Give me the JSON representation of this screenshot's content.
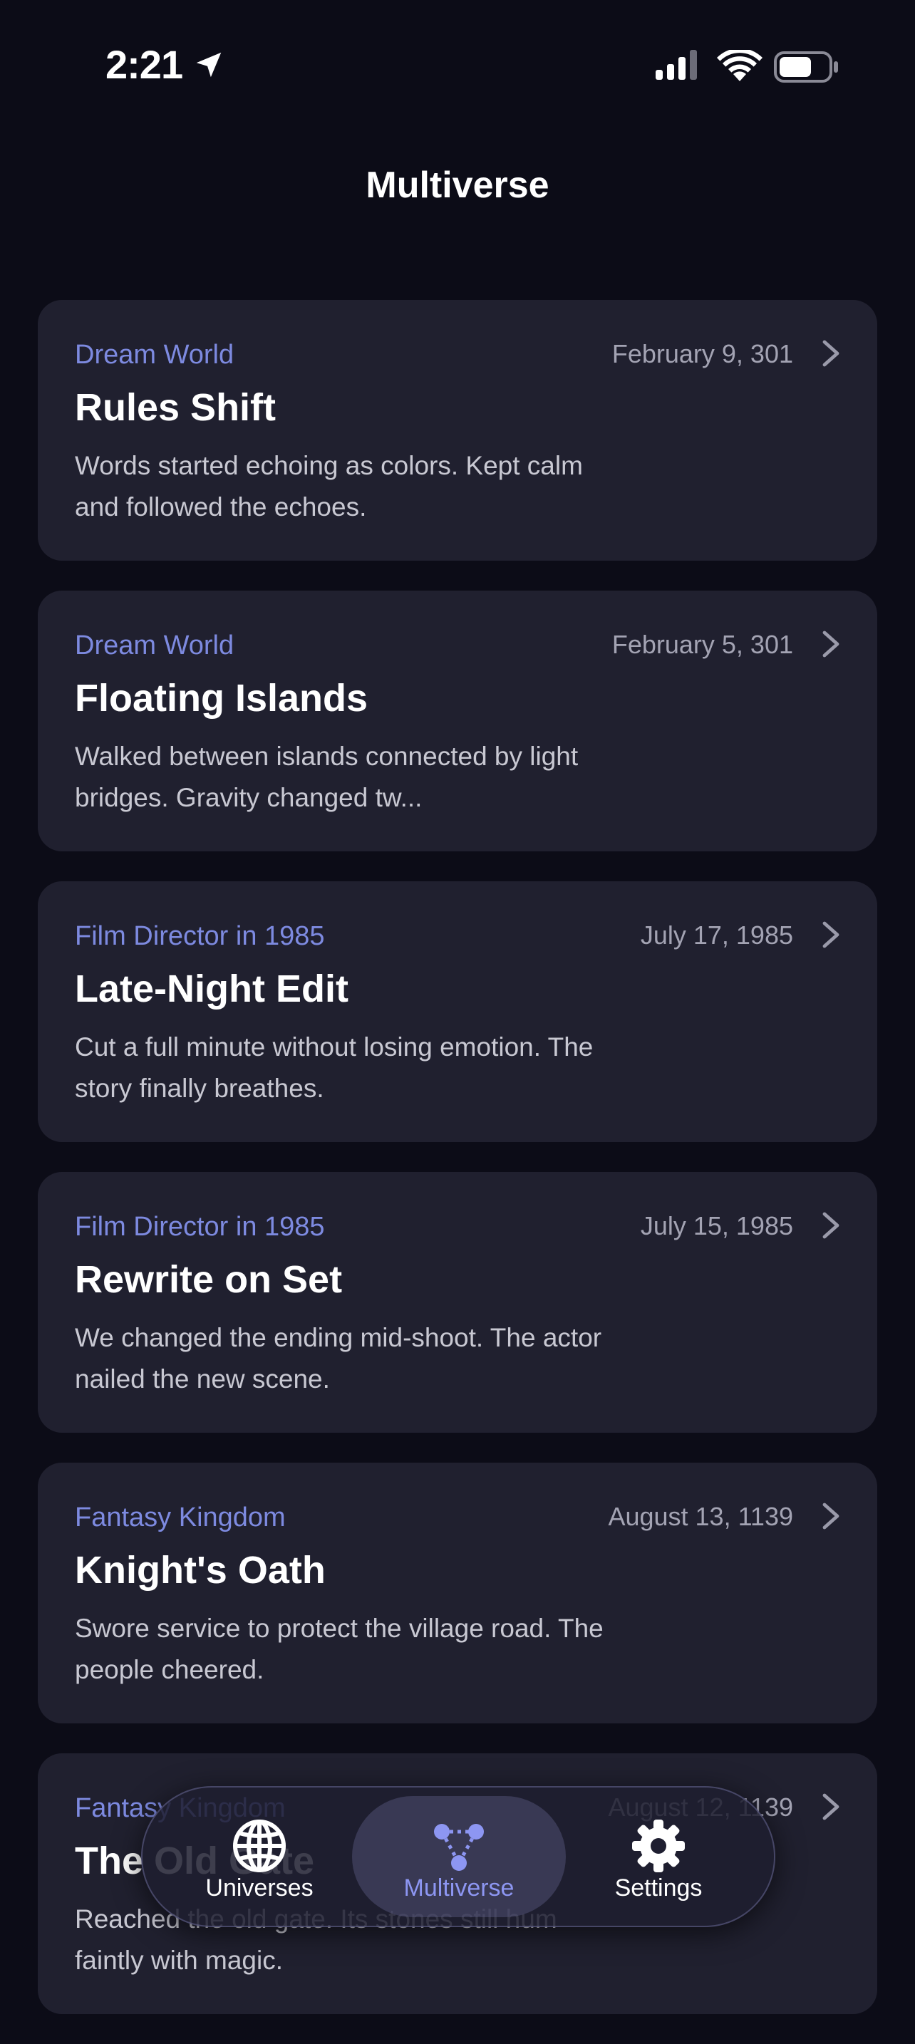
{
  "status_bar": {
    "time": "2:21",
    "icons": [
      "location-arrow-icon",
      "cellular-signal-icon",
      "wifi-icon",
      "battery-icon"
    ]
  },
  "header": {
    "title": "Multiverse"
  },
  "entries": [
    {
      "universe": "Dream World",
      "date": "February 9, 301",
      "title": "Rules Shift",
      "summary": "Words started echoing as colors. Kept calm and followed the echoes."
    },
    {
      "universe": "Dream World",
      "date": "February 5, 301",
      "title": "Floating Islands",
      "summary": "Walked between islands connected by light bridges. Gravity changed tw..."
    },
    {
      "universe": "Film Director in 1985",
      "date": "July 17, 1985",
      "title": "Late-Night Edit",
      "summary": "Cut a full minute without losing emotion. The story finally breathes."
    },
    {
      "universe": "Film Director in 1985",
      "date": "July 15, 1985",
      "title": "Rewrite on Set",
      "summary": "We changed the ending mid-shoot. The actor nailed the new scene."
    },
    {
      "universe": "Fantasy Kingdom",
      "date": "August 13, 1139",
      "title": "Knight's Oath",
      "summary": "Swore service to protect the village road. The people cheered."
    },
    {
      "universe": "Fantasy Kingdom",
      "date": "August 12, 1139",
      "title": "The Old Gate",
      "summary": "Reached the old gate. Its stones still hum faintly with magic."
    }
  ],
  "tab_bar": {
    "tabs": [
      {
        "label": "Universes",
        "icon": "globe-icon",
        "active": false
      },
      {
        "label": "Multiverse",
        "icon": "multiverse-nodes-icon",
        "active": true
      },
      {
        "label": "Settings",
        "icon": "gear-icon",
        "active": false
      }
    ]
  },
  "colors": {
    "background": "#0c0c17",
    "card": "#20202f",
    "accent": "#7d8ae0",
    "active_tab": "#8d96f2"
  }
}
